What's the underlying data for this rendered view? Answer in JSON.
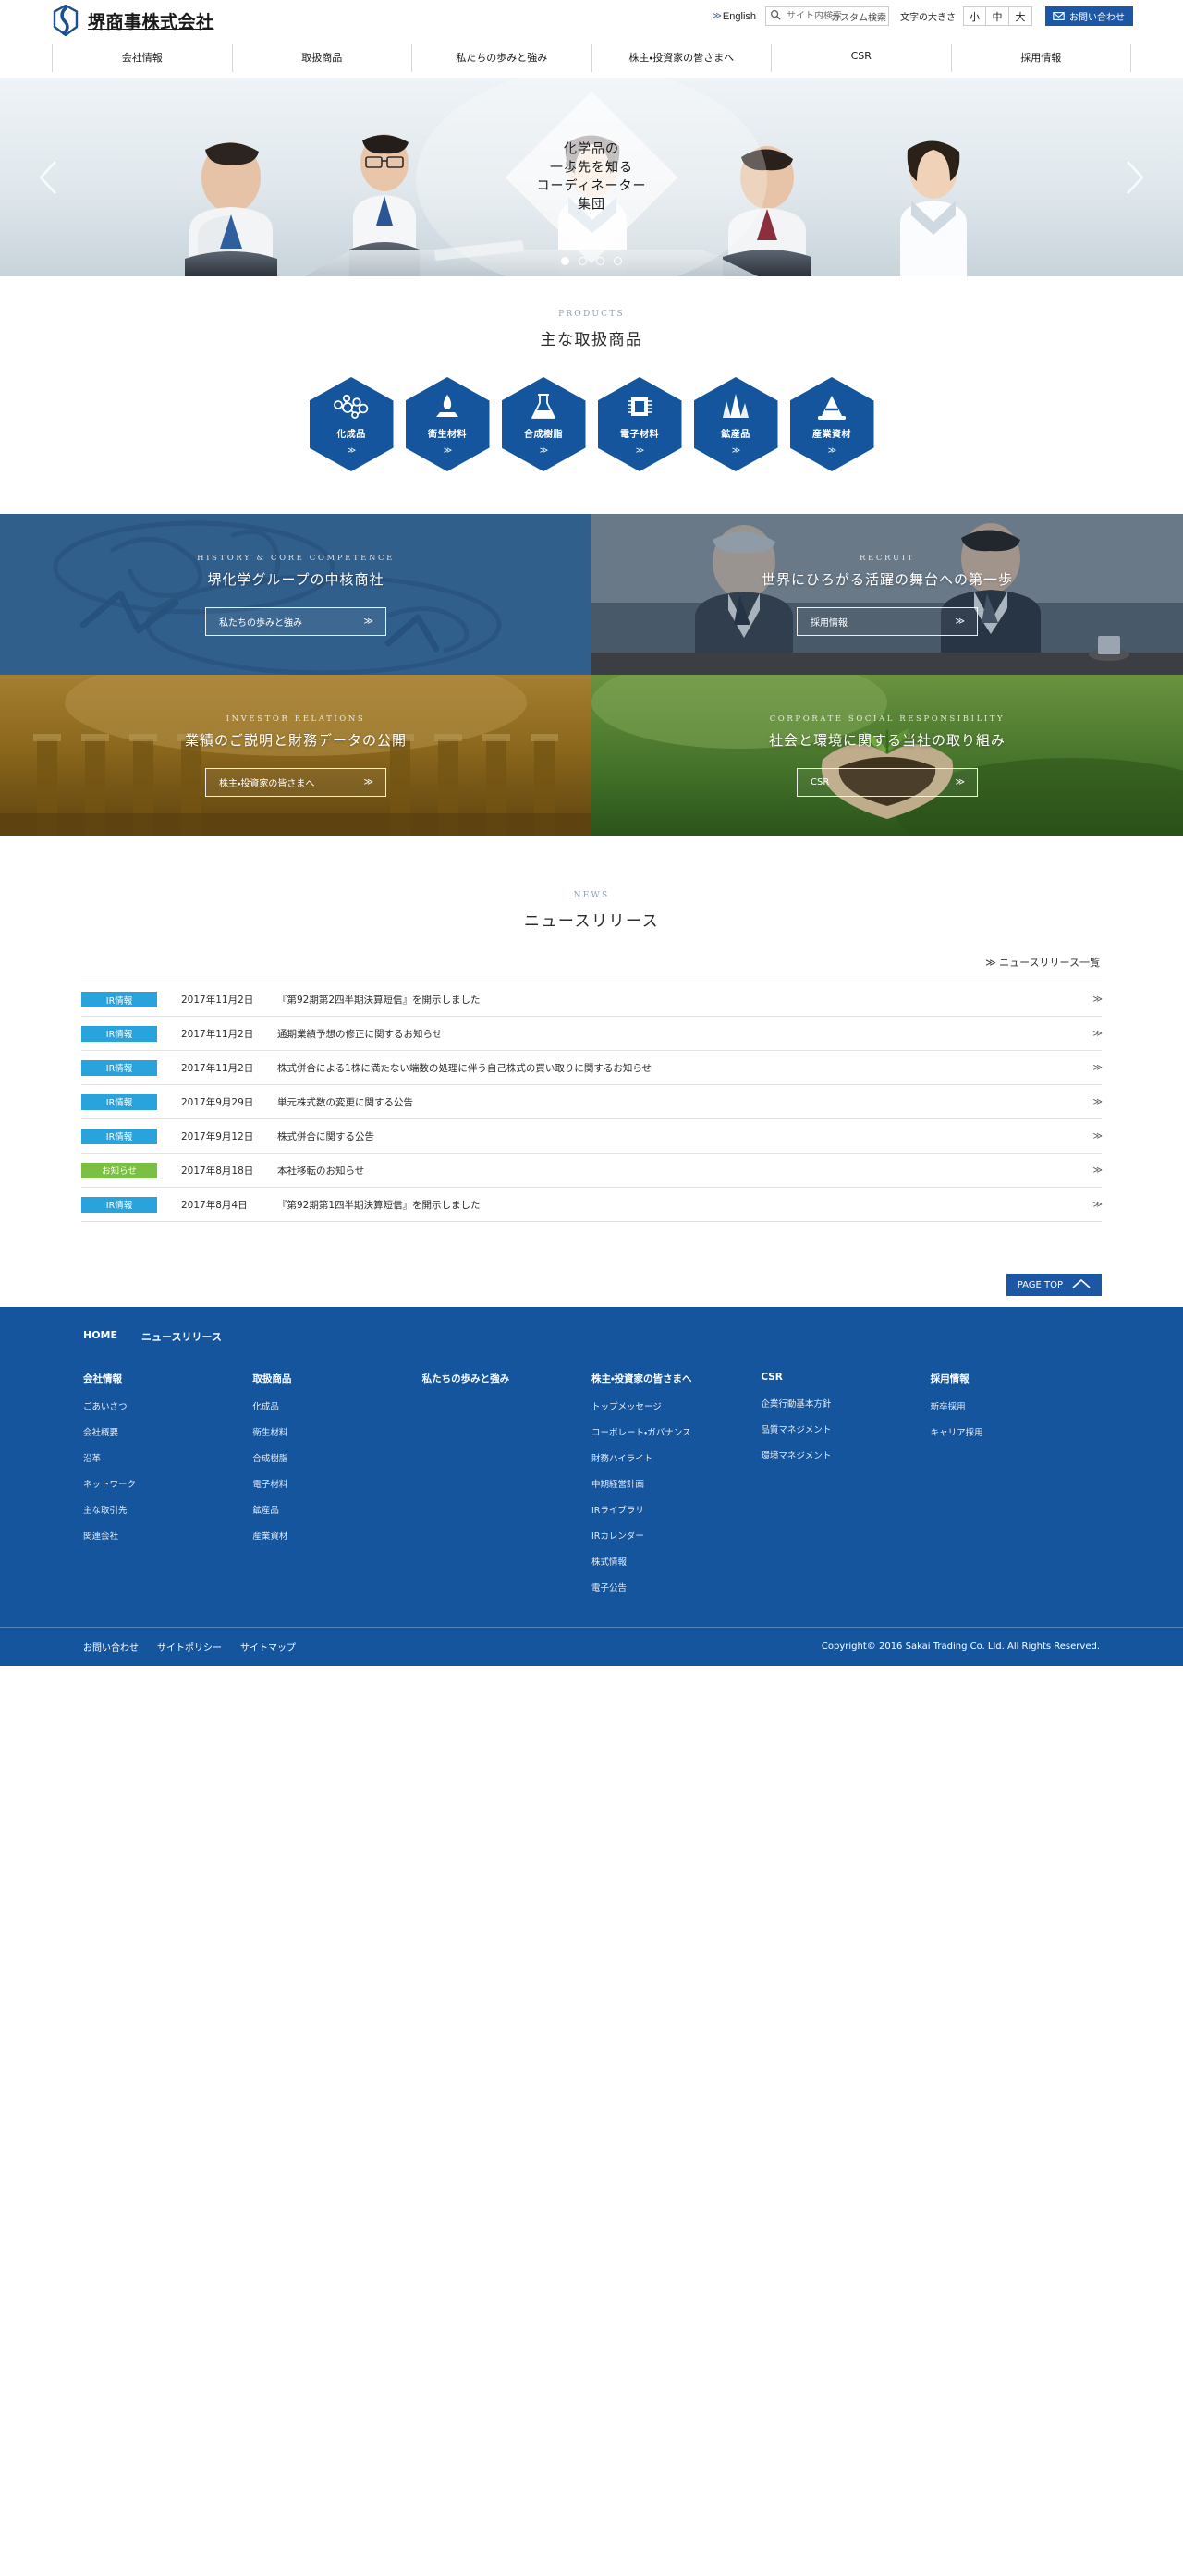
{
  "header": {
    "logo_text": "堺商事株式会社",
    "logo_icon": "sakai-logo-icon",
    "english_label": "English",
    "english_chevron": "≫",
    "search": {
      "placeholder": "サイト内検索",
      "value": "",
      "watermark": "カスタム検索",
      "icon": "search-icon"
    },
    "fontsize": {
      "label": "文字の大きさ",
      "options": [
        "小",
        "中",
        "大"
      ]
    },
    "contact": {
      "label": "お問い合わせ",
      "icon": "mail-icon",
      "color": "#1b57a5"
    }
  },
  "gnav": [
    {
      "label": "会社情報"
    },
    {
      "label": "取扱商品"
    },
    {
      "label": "私たちの歩みと強み"
    },
    {
      "label": "株主・投資家の皆さまへ"
    },
    {
      "label": "CSR"
    },
    {
      "label": "採用情報"
    }
  ],
  "hero": {
    "caption_lines": [
      "化学品の",
      "一歩先を知る",
      "コーディネーター",
      "集団"
    ],
    "prev_icon": "chevron-left-icon",
    "next_icon": "chevron-right-icon",
    "dots": 4,
    "active_dot": 0
  },
  "products": {
    "section_en": "PRODUCTS",
    "section_jp": "主な取扱商品",
    "chevron": "≫",
    "accent": "#14559e",
    "items": [
      {
        "label": "化成品",
        "icon": "molecule-icon"
      },
      {
        "label": "衛生材料",
        "icon": "droplet-icon"
      },
      {
        "label": "合成樹脂",
        "icon": "flask-icon"
      },
      {
        "label": "電子材料",
        "icon": "chip-icon"
      },
      {
        "label": "鉱産品",
        "icon": "crystal-icon"
      },
      {
        "label": "産業資材",
        "icon": "cone-icon"
      }
    ]
  },
  "panels": [
    {
      "en": "HISTORY & CORE COMPETENCE",
      "jp": "堺化学グループの中核商社",
      "button": "私たちの歩みと強み",
      "chevron": "≫",
      "theme": "history"
    },
    {
      "en": "RECRUIT",
      "jp": "世界にひろがる活躍の舞台への第一歩",
      "button": "採用情報",
      "chevron": "≫",
      "theme": "recruit"
    },
    {
      "en": "INVESTOR RELATIONS",
      "jp": "業績のご説明と財務データの公開",
      "button": "株主・投資家の皆さまへ",
      "chevron": "≫",
      "theme": "ir"
    },
    {
      "en": "CORPORATE SOCIAL RESPONSIBILITY",
      "jp": "社会と環境に関する当社の取り組み",
      "button": "CSR",
      "chevron": "≫",
      "theme": "csr"
    }
  ],
  "news": {
    "section_en": "NEWS",
    "section_jp": "ニュースリリース",
    "all_link": "≫ ニュースリリース一覧",
    "badge_colors": {
      "IR情報": "#29a3dc",
      "お知らせ": "#7ac143"
    },
    "arrow": "≫",
    "items": [
      {
        "badge": "IR情報",
        "date": "2017年11月2日",
        "title": "『第92期第2四半期決算短信』を開示しました"
      },
      {
        "badge": "IR情報",
        "date": "2017年11月2日",
        "title": "通期業績予想の修正に関するお知らせ"
      },
      {
        "badge": "IR情報",
        "date": "2017年11月2日",
        "title": "株式併合による1株に満たない端数の処理に伴う自己株式の買い取りに関するお知らせ"
      },
      {
        "badge": "IR情報",
        "date": "2017年9月29日",
        "title": "単元株式数の変更に関する公告"
      },
      {
        "badge": "IR情報",
        "date": "2017年9月12日",
        "title": "株式併合に関する公告"
      },
      {
        "badge": "お知らせ",
        "date": "2017年8月18日",
        "title": "本社移転のお知らせ"
      },
      {
        "badge": "IR情報",
        "date": "2017年8月4日",
        "title": "『第92期第1四半期決算短信』を開示しました"
      }
    ]
  },
  "pagetop": {
    "label": "PAGE TOP",
    "icon": "chevron-up-icon"
  },
  "footer": {
    "top_links": [
      "HOME",
      "ニュースリリース"
    ],
    "columns": [
      {
        "head": "会社情報",
        "links": [
          "ごあいさつ",
          "会社概要",
          "沿革",
          "ネットワーク",
          "主な取引先",
          "関連会社"
        ]
      },
      {
        "head": "取扱商品",
        "links": [
          "化成品",
          "衛生材料",
          "合成樹脂",
          "電子材料",
          "鉱産品",
          "産業資材"
        ]
      },
      {
        "head": "私たちの歩みと強み",
        "links": []
      },
      {
        "head": "株主・投資家の皆さまへ",
        "links": [
          "トップメッセージ",
          "コーポレート・ガバナンス",
          "財務ハイライト",
          "中期経営計画",
          "IRライブラリ",
          "IRカレンダー",
          "株式情報",
          "電子公告"
        ]
      },
      {
        "head": "CSR",
        "links": [
          "企業行動基本方針",
          "品質マネジメント",
          "環境マネジメント"
        ]
      },
      {
        "head": "採用情報",
        "links": [
          "新卒採用",
          "キャリア採用"
        ]
      }
    ],
    "bottom_links": [
      "お問い合わせ",
      "サイトポリシー",
      "サイトマップ"
    ],
    "copyright": "Copyright© 2016 Sakai Trading Co. Lld. All Rights Reserved."
  }
}
